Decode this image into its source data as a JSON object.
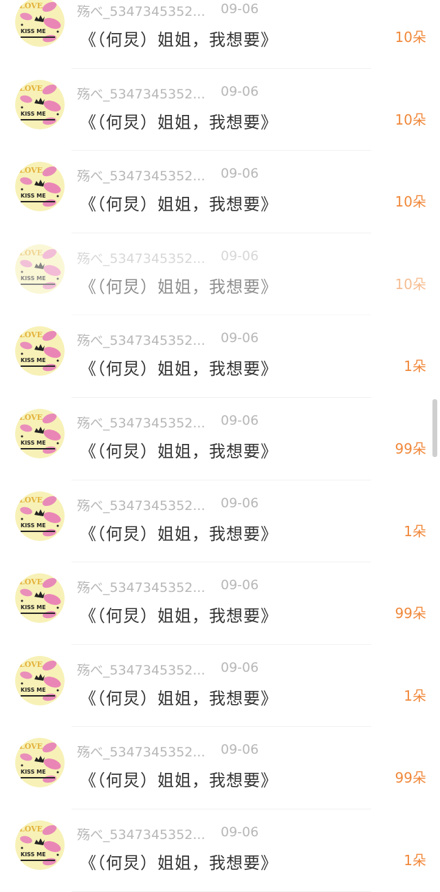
{
  "colors": {
    "accent": "#f0883a",
    "meta": "#b7b7b7",
    "message": "#333333"
  },
  "rows": [
    {
      "username": "殇べ_5347345352...",
      "date": "09-06",
      "message": "《（何炅）姐姐，我想要》",
      "gift": "10朵",
      "faded": false
    },
    {
      "username": "殇べ_5347345352...",
      "date": "09-06",
      "message": "《（何炅）姐姐，我想要》",
      "gift": "10朵",
      "faded": false
    },
    {
      "username": "殇べ_5347345352...",
      "date": "09-06",
      "message": "《（何炅）姐姐，我想要》",
      "gift": "10朵",
      "faded": false
    },
    {
      "username": "殇べ_5347345352...",
      "date": "09-06",
      "message": "《（何炅）姐姐，我想要》",
      "gift": "10朵",
      "faded": true
    },
    {
      "username": "殇べ_5347345352...",
      "date": "09-06",
      "message": "《（何炅）姐姐，我想要》",
      "gift": "1朵",
      "faded": false
    },
    {
      "username": "殇べ_5347345352...",
      "date": "09-06",
      "message": "《（何炅）姐姐，我想要》",
      "gift": "99朵",
      "faded": false
    },
    {
      "username": "殇べ_5347345352...",
      "date": "09-06",
      "message": "《（何炅）姐姐，我想要》",
      "gift": "1朵",
      "faded": false
    },
    {
      "username": "殇べ_5347345352...",
      "date": "09-06",
      "message": "《（何炅）姐姐，我想要》",
      "gift": "99朵",
      "faded": false
    },
    {
      "username": "殇べ_5347345352...",
      "date": "09-06",
      "message": "《（何炅）姐姐，我想要》",
      "gift": "1朵",
      "faded": false
    },
    {
      "username": "殇べ_5347345352...",
      "date": "09-06",
      "message": "《（何炅）姐姐，我想要》",
      "gift": "99朵",
      "faded": false
    },
    {
      "username": "殇べ_5347345352...",
      "date": "09-06",
      "message": "《（何炅）姐姐，我想要》",
      "gift": "1朵",
      "faded": false
    }
  ],
  "avatar": {
    "top_text": "LOVE",
    "bottom_text": "KISS ME"
  }
}
